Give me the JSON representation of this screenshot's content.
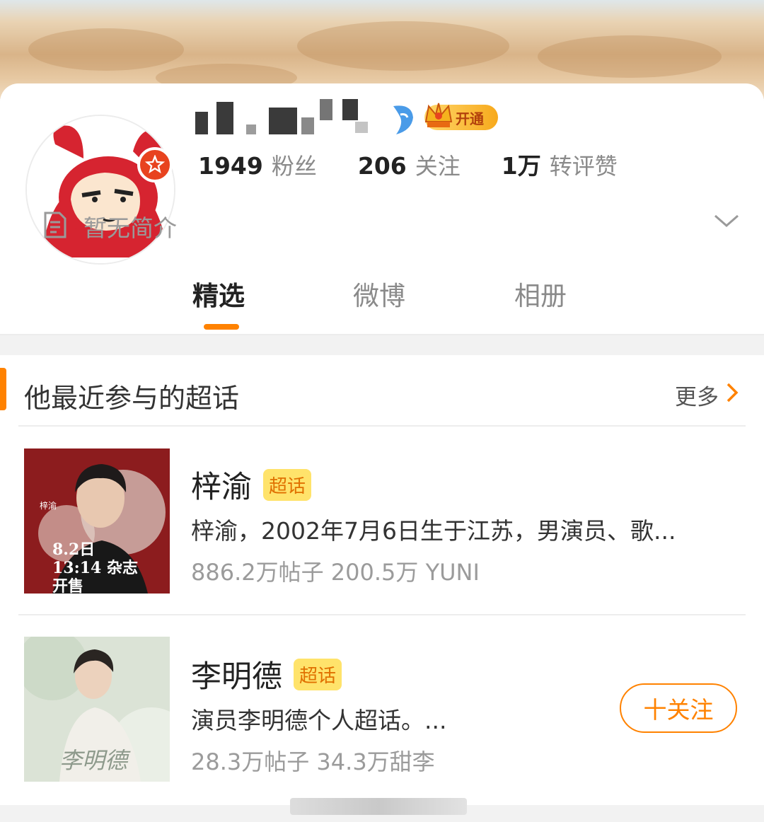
{
  "profile": {
    "stats": [
      {
        "num": "1949",
        "label": "粉丝"
      },
      {
        "num": "206",
        "label": "关注"
      },
      {
        "num": "1万",
        "label": "转评赞"
      }
    ],
    "vip_label": "开通",
    "bio": "暂无简介"
  },
  "tabs": [
    {
      "label": "精选",
      "active": true
    },
    {
      "label": "微博",
      "active": false
    },
    {
      "label": "相册",
      "active": false
    }
  ],
  "section": {
    "title": "他最近参与的超话",
    "more_label": "更多"
  },
  "items": [
    {
      "name": "梓渝",
      "tag": "超话",
      "desc": "梓渝，2002年7月6日生于江苏，男演员、歌...",
      "meta": "886.2万帖子 200.5万 YUNI",
      "thumb_text": "8.2日 13:14 杂志开售",
      "thumb_small": "梓渝"
    },
    {
      "name": "李明德",
      "tag": "超话",
      "desc": "演员李明德个人超话。...",
      "meta": "28.3万帖子 34.3万甜李",
      "thumb_text": "李明德",
      "follow_label": "十关注"
    }
  ],
  "colors": {
    "accent": "#ff8200",
    "tag_bg": "#ffe36b",
    "tag_text": "#e07000"
  }
}
